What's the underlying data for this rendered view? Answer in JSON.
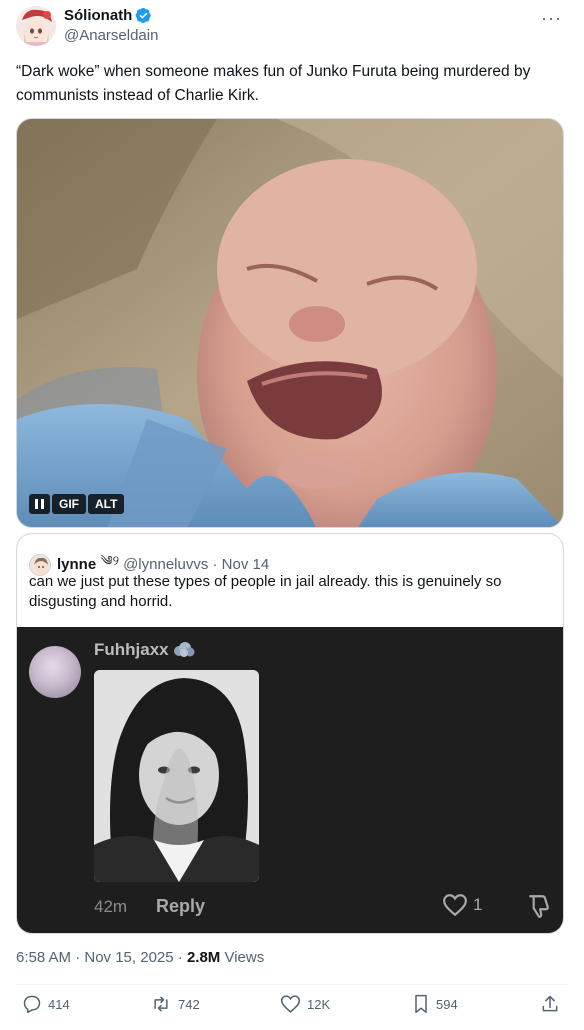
{
  "author": {
    "display_name": "Sólionath",
    "handle": "@Anarseldain",
    "verified": true
  },
  "more_label": "···",
  "tweet": {
    "text": "“Dark woke” when someone makes fun of Junko Furuta being murdered by communists instead of Charlie Kirk."
  },
  "media": {
    "badges": {
      "gif": "GIF",
      "alt": "ALT"
    }
  },
  "quote": {
    "display_name": "lynne",
    "name_emoji": "༄୨",
    "handle_date": "@lynneluvvs · Nov 14",
    "text": "can we just put these types of people in jail already. this is genuinely so disgusting and horrid.",
    "embedded_comment": {
      "username": "Fuhhjaxx",
      "time": "42m",
      "reply_label": "Reply",
      "like_count": "1"
    }
  },
  "meta": {
    "timestamp": "6:58 AM · Nov 15, 2025 · ",
    "views_count": "2.8M",
    "views_label": " Views"
  },
  "actions": {
    "replies": "414",
    "reposts": "742",
    "likes": "12K",
    "bookmarks": "594"
  },
  "colors": {
    "verified_blue": "#1d9bf0",
    "text_primary": "#0f1419",
    "text_secondary": "#536471",
    "quote_media_bg": "#1e1e1e"
  }
}
